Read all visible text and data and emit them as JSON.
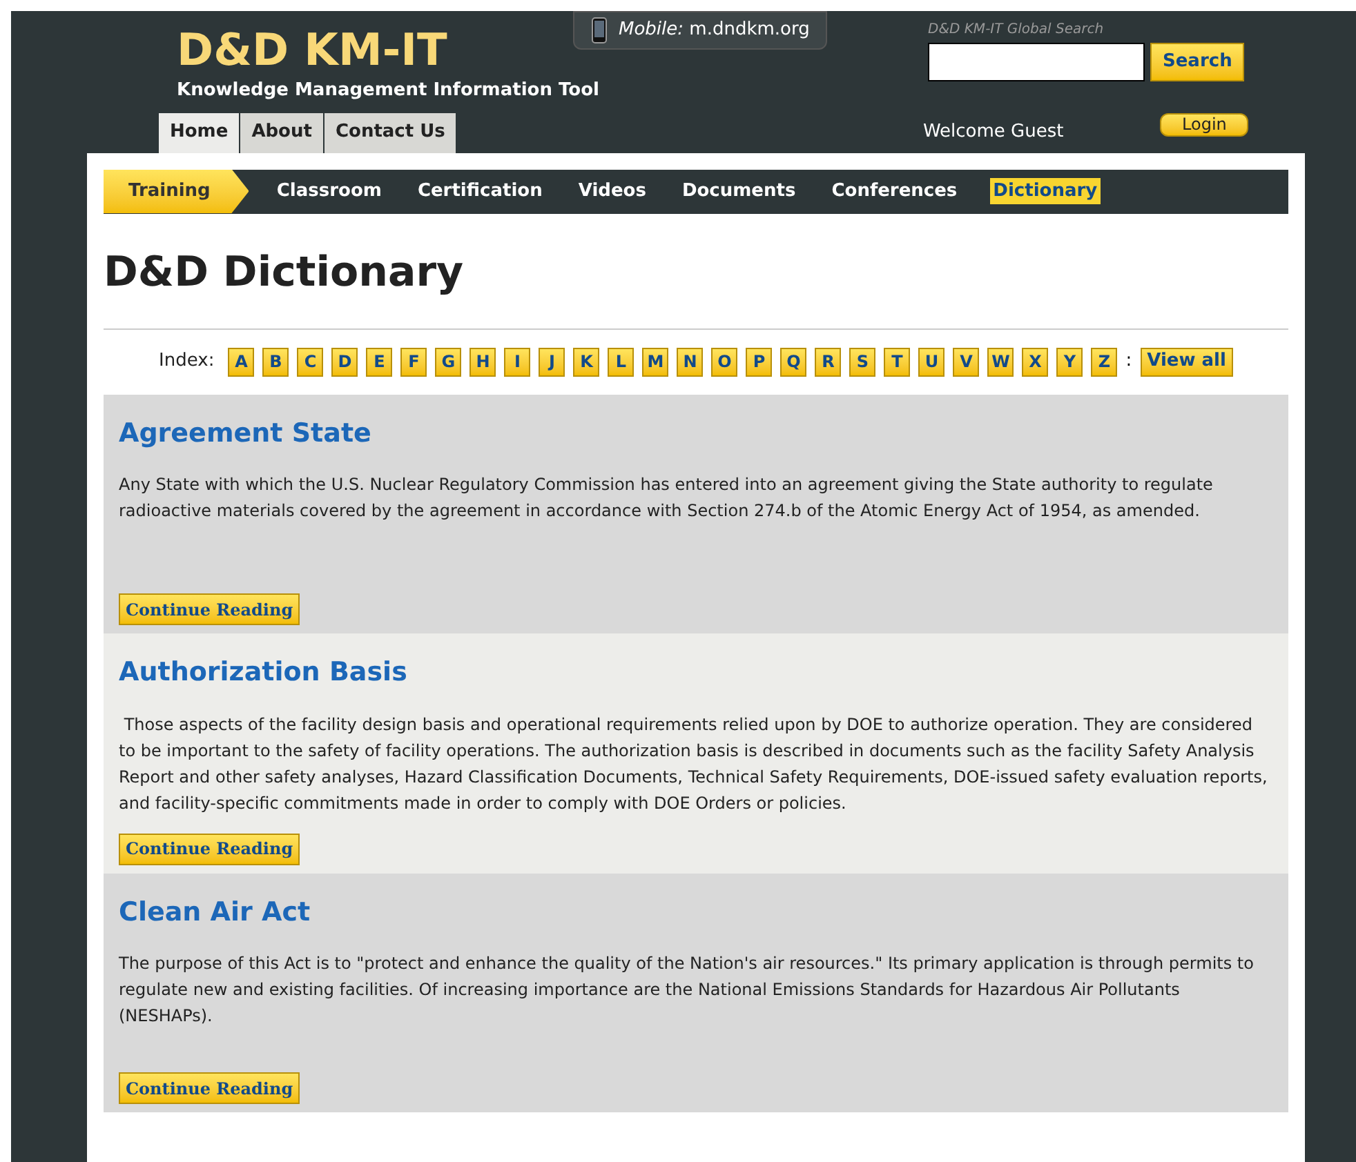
{
  "header": {
    "logo": "D&D KM-IT",
    "tagline": "Knowledge Management Information Tool",
    "mobile_label": "Mobile:",
    "mobile_url": "m.dndkm.org",
    "search_caption": "D&D KM-IT Global Search",
    "search_button": "Search",
    "welcome": "Welcome Guest",
    "login": "Login"
  },
  "top_tabs": [
    {
      "label": "Home",
      "selected": true
    },
    {
      "label": "About",
      "selected": false
    },
    {
      "label": "Contact Us",
      "selected": false
    }
  ],
  "nav": {
    "section": "Training",
    "items": [
      {
        "label": "Classroom",
        "selected": false
      },
      {
        "label": "Certification",
        "selected": false
      },
      {
        "label": "Videos",
        "selected": false
      },
      {
        "label": "Documents",
        "selected": false
      },
      {
        "label": "Conferences",
        "selected": false
      },
      {
        "label": "Dictionary",
        "selected": true
      }
    ]
  },
  "page_title": "D&D Dictionary",
  "index": {
    "label": "Index:",
    "letters": [
      "A",
      "B",
      "C",
      "D",
      "E",
      "F",
      "G",
      "H",
      "I",
      "J",
      "K",
      "L",
      "M",
      "N",
      "O",
      "P",
      "Q",
      "R",
      "S",
      "T",
      "U",
      "V",
      "W",
      "X",
      "Y",
      "Z"
    ],
    "separator": ":",
    "view_all": "View all"
  },
  "entries": [
    {
      "term": "Agreement State",
      "definition": "Any State with which the U.S. Nuclear Regulatory Commission has entered into an agreement giving the State authority to regulate radioactive materials covered by the agreement in accordance with Section 274.b of the Atomic Energy Act of 1954, as amended.",
      "button": "Continue Reading"
    },
    {
      "term": "Authorization Basis",
      "definition": " Those aspects of the facility design basis and operational requirements relied upon by DOE to authorize operation. They are considered to be important to the safety of facility operations. The authorization basis is described in documents such as the facility Safety Analysis Report and other safety analyses, Hazard Classification Documents, Technical Safety Requirements, DOE-issued safety evaluation reports, and facility-specific commitments made in order to comply with DOE Orders or policies.",
      "button": "Continue Reading"
    },
    {
      "term": "Clean Air Act",
      "definition": "The purpose of this Act is to \"protect and enhance the quality of the Nation's air resources.\" Its primary application is through permits to regulate new and existing facilities. Of increasing importance are the National Emissions Standards for Hazardous Air Pollutants (NESHAPs).",
      "button": "Continue Reading"
    }
  ]
}
